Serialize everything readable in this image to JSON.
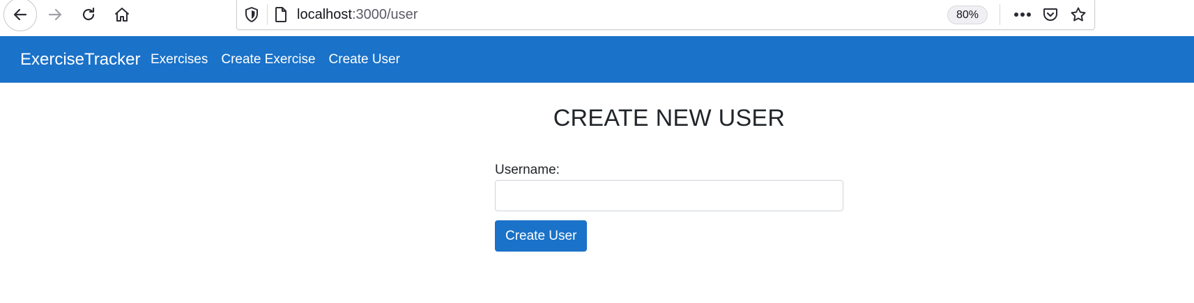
{
  "browser": {
    "url_host": "localhost",
    "url_path": ":3000/user",
    "zoom_level": "80%",
    "icons": {
      "back": "back-arrow-icon",
      "forward": "forward-arrow-icon",
      "reload": "reload-icon",
      "home": "home-icon",
      "tracking_protection": "shield-icon",
      "page_info": "page-icon",
      "more": "more-dots-icon",
      "pocket": "pocket-icon",
      "bookmark": "star-icon"
    }
  },
  "navbar": {
    "brand": "ExerciseTracker",
    "links": [
      {
        "label": "Exercises"
      },
      {
        "label": "Create Exercise"
      },
      {
        "label": "Create User"
      }
    ],
    "background_color": "#1a72c9"
  },
  "main": {
    "title": "CREATE NEW USER",
    "form": {
      "username_label": "Username:",
      "username_value": "",
      "submit_label": "Create User"
    }
  },
  "colors": {
    "accent": "#1a72c9",
    "text": "#212529"
  }
}
